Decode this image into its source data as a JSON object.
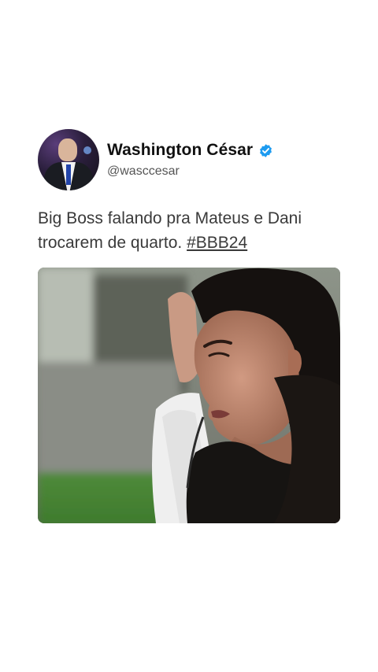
{
  "tweet": {
    "display_name": "Washington César",
    "handle": "@wasccesar",
    "verified_icon": "verified-badge-icon",
    "text_main": "Big Boss falando pra Mateus e Dani trocarem de quarto.",
    "hashtag": "#BBB24",
    "accent_color": "#1d9bf0"
  }
}
